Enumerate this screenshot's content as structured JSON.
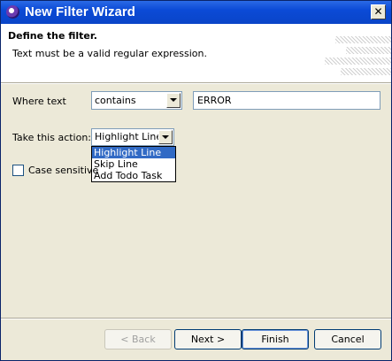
{
  "window": {
    "title": "New Filter Wizard",
    "close_glyph": "✕"
  },
  "header": {
    "title": "Define the filter.",
    "message": "Text must be a valid regular expression."
  },
  "form": {
    "where_text_label": "Where text",
    "where_text_mode": "contains",
    "where_text_value": "ERROR",
    "action_label": "Take this action:",
    "action_selected": "Highlight Line",
    "action_options": [
      "Highlight Line",
      "Skip Line",
      "Add Todo Task"
    ],
    "case_sensitive_label": "Case sensitive",
    "case_sensitive_checked": false
  },
  "buttons": {
    "back": "< Back",
    "next": "Next >",
    "finish": "Finish",
    "cancel": "Cancel"
  }
}
